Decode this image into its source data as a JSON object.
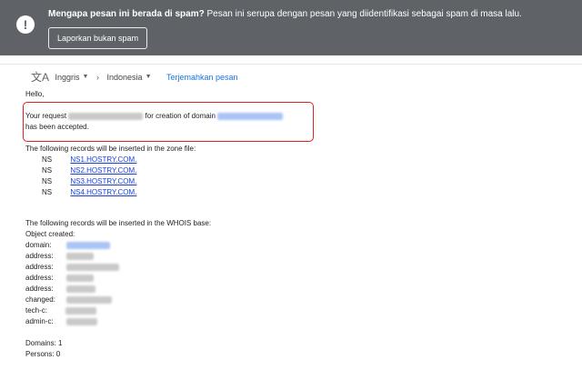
{
  "banner": {
    "title": "Mengapa pesan ini berada di spam?",
    "message": " Pesan ini serupa dengan pesan yang diidentifikasi sebagai spam di masa lalu.",
    "report_button": "Laporkan bukan spam",
    "icon": "warning-icon"
  },
  "translate": {
    "from": "Inggris",
    "to": "Indonesia",
    "link": "Terjemahkan pesan"
  },
  "email": {
    "greeting": "Hello,",
    "request_prefix": "Your request",
    "request_mid": "for creation of domain",
    "accepted": "has been accepted.",
    "zone_intro": "The following records will be inserted in the zone file:",
    "ns_records": [
      {
        "type": "NS",
        "host": "NS1.HOSTRY.COM."
      },
      {
        "type": "NS",
        "host": "NS2.HOSTRY.COM."
      },
      {
        "type": "NS",
        "host": "NS3.HOSTRY.COM."
      },
      {
        "type": "NS",
        "host": "NS4.HOSTRY.COM."
      }
    ],
    "whois_intro": "The following records will be inserted in the WHOIS base:",
    "object_created": "Object created:",
    "whois_labels": [
      "domain:",
      "address:",
      "address:",
      "address:",
      "address:",
      "changed:",
      "tech-c:",
      "admin-c:"
    ],
    "domains": "Domains: 1",
    "persons": "Persons: 0"
  }
}
